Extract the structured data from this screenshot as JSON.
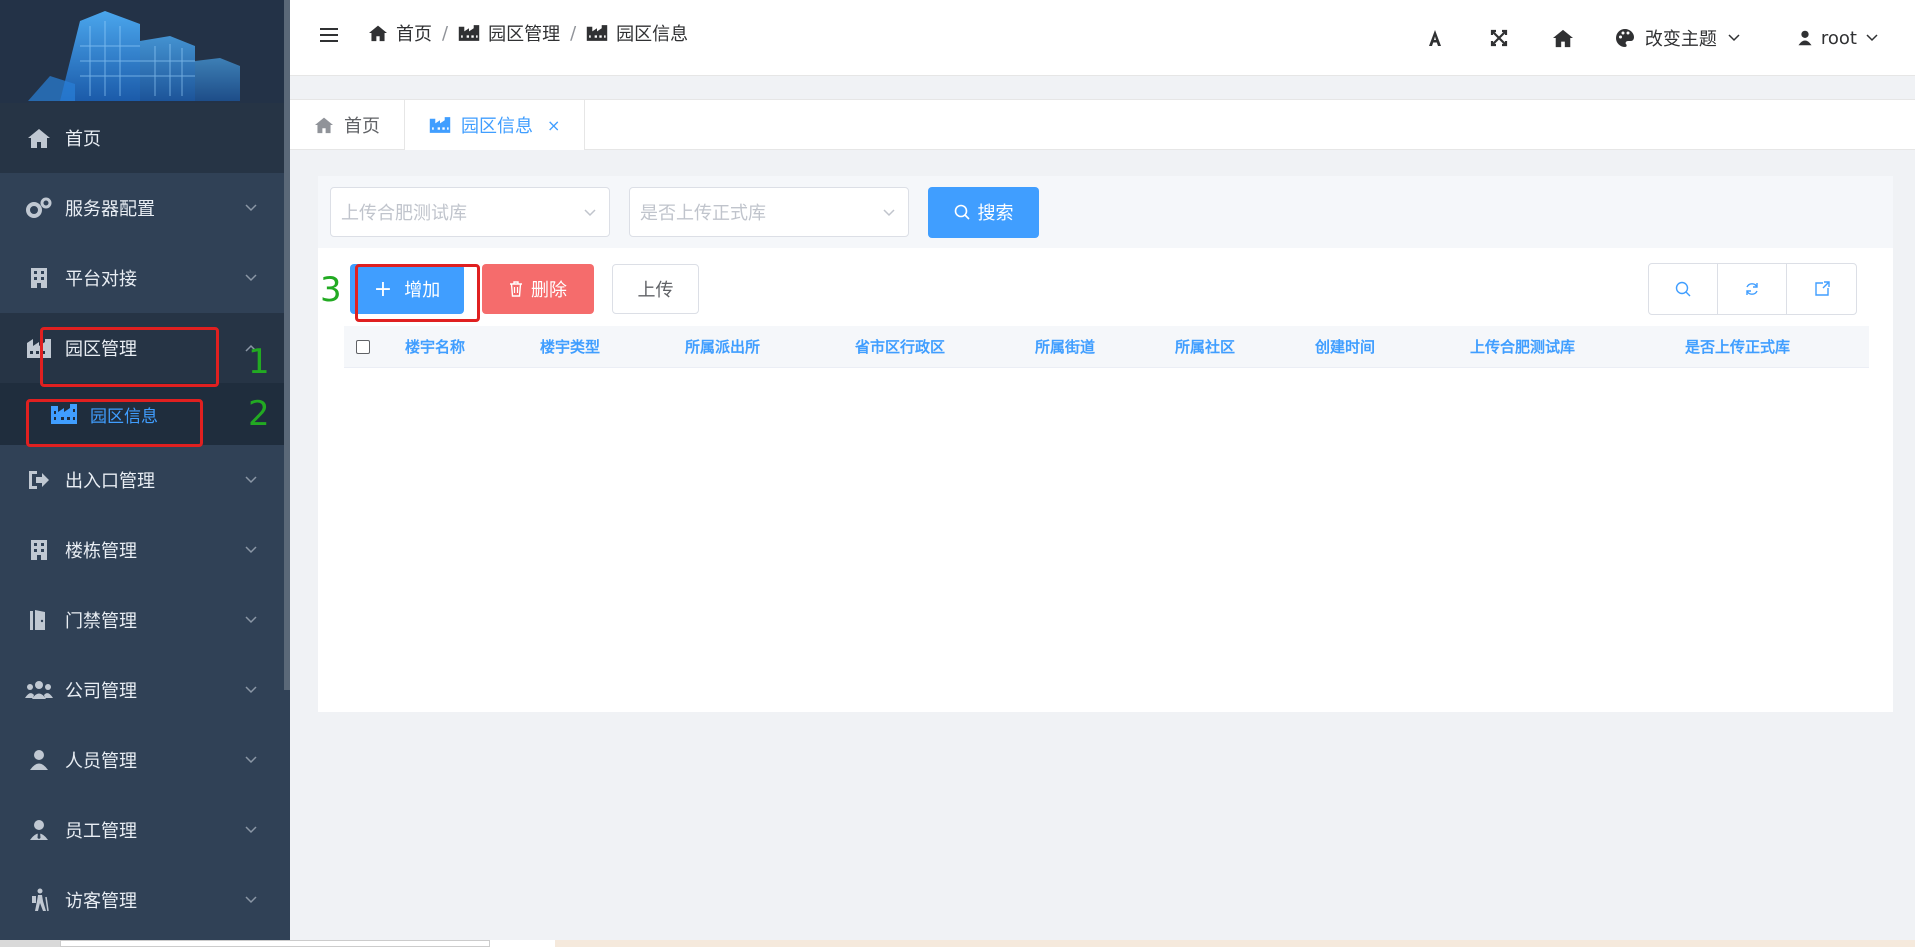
{
  "sidebar": {
    "items": [
      {
        "label": "首页",
        "icon": "home-icon"
      },
      {
        "label": "服务器配置",
        "icon": "gears-icon"
      },
      {
        "label": "平台对接",
        "icon": "building-icon"
      },
      {
        "label": "园区管理",
        "icon": "industry-icon"
      },
      {
        "label": "园区信息",
        "icon": "industry-icon"
      },
      {
        "label": "出入口管理",
        "icon": "sign-out-icon"
      },
      {
        "label": "楼栋管理",
        "icon": "building-icon"
      },
      {
        "label": "门禁管理",
        "icon": "door-icon"
      },
      {
        "label": "公司管理",
        "icon": "users-icon"
      },
      {
        "label": "人员管理",
        "icon": "user-icon"
      },
      {
        "label": "员工管理",
        "icon": "user-tie-icon"
      },
      {
        "label": "访客管理",
        "icon": "hiking-icon"
      }
    ]
  },
  "header": {
    "breadcrumb": [
      "首页",
      "园区管理",
      "园区信息"
    ],
    "theme_label": "改变主题",
    "user_label": "root"
  },
  "tabs": [
    {
      "label": "首页"
    },
    {
      "label": "园区信息",
      "close": "×"
    }
  ],
  "filters": {
    "select1_placeholder": "上传合肥测试库",
    "select2_placeholder": "是否上传正式库",
    "search_label": "搜索"
  },
  "actions": {
    "add_label": "增加",
    "add_icon": "+",
    "delete_label": "删除",
    "upload_label": "上传"
  },
  "table": {
    "columns": [
      "楼宇名称",
      "楼宇类型",
      "所属派出所",
      "省市区行政区",
      "所属街道",
      "所属社区",
      "创建时间",
      "上传合肥测试库",
      "是否上传正式库"
    ]
  },
  "annotations": [
    "1",
    "2",
    "3"
  ],
  "colors": {
    "sidebar_bg": "#304156",
    "primary": "#409eff",
    "danger": "#f56c6c",
    "annotation_box": "#e02020",
    "annotation_text": "#22aa22"
  }
}
